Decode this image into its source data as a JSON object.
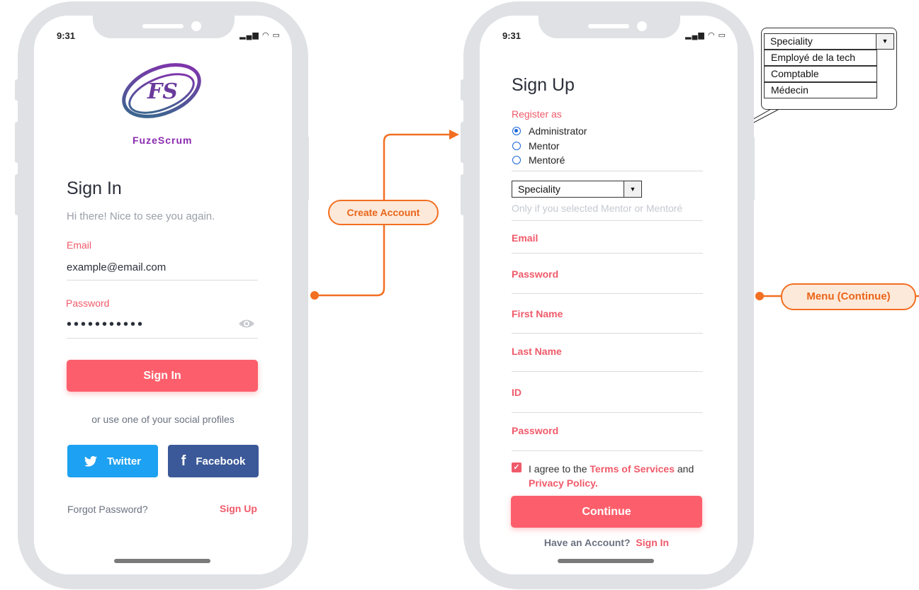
{
  "status": {
    "time": "9:31"
  },
  "signin": {
    "logo_text": "FS",
    "brand": "FuzeScrum",
    "title": "Sign In",
    "subtitle": "Hi there! Nice to see you again.",
    "email_label": "Email",
    "email_value": "example@email.com",
    "password_label": "Password",
    "password_value": "•••••••••••",
    "signin_button": "Sign In",
    "social_text": "or use one of your social profiles",
    "twitter_button": "Twitter",
    "facebook_button": "Facebook",
    "forgot_password": "Forgot Password?",
    "signup_link": "Sign Up"
  },
  "signup": {
    "title": "Sign Up",
    "register_label": "Register as",
    "roles": [
      {
        "label": "Administrator",
        "selected": true
      },
      {
        "label": "Mentor",
        "selected": false
      },
      {
        "label": "Mentoré",
        "selected": false
      }
    ],
    "speciality_select": "Speciality",
    "speciality_hint": "Only if you selected Mentor or Mentoré",
    "email_label": "Email",
    "password_label": "Password",
    "first_name_label": "First Name",
    "last_name_label": "Last Name",
    "id_label": "ID",
    "password2_label": "Password",
    "agree_text": "I agree to the",
    "terms_link": "Terms of Services",
    "and_text": "and",
    "privacy_link": "Privacy Policy.",
    "agree_checked": true,
    "continue_button": "Continue",
    "have_account_text": "Have an Account?",
    "signin_link": "Sign In"
  },
  "dropdown_popup": {
    "selected": "Speciality",
    "options": [
      "Employé de la tech",
      "Comptable",
      "Médecin"
    ]
  },
  "flow": {
    "create_account": "Create Account",
    "menu_continue": "Menu (Continue)"
  },
  "colors": {
    "accent_red": "#fc5f6b",
    "twitter": "#1da1f2",
    "facebook": "#3b5998",
    "flow_orange": "#f26f22",
    "phone_frame": "#dfe1e5"
  }
}
